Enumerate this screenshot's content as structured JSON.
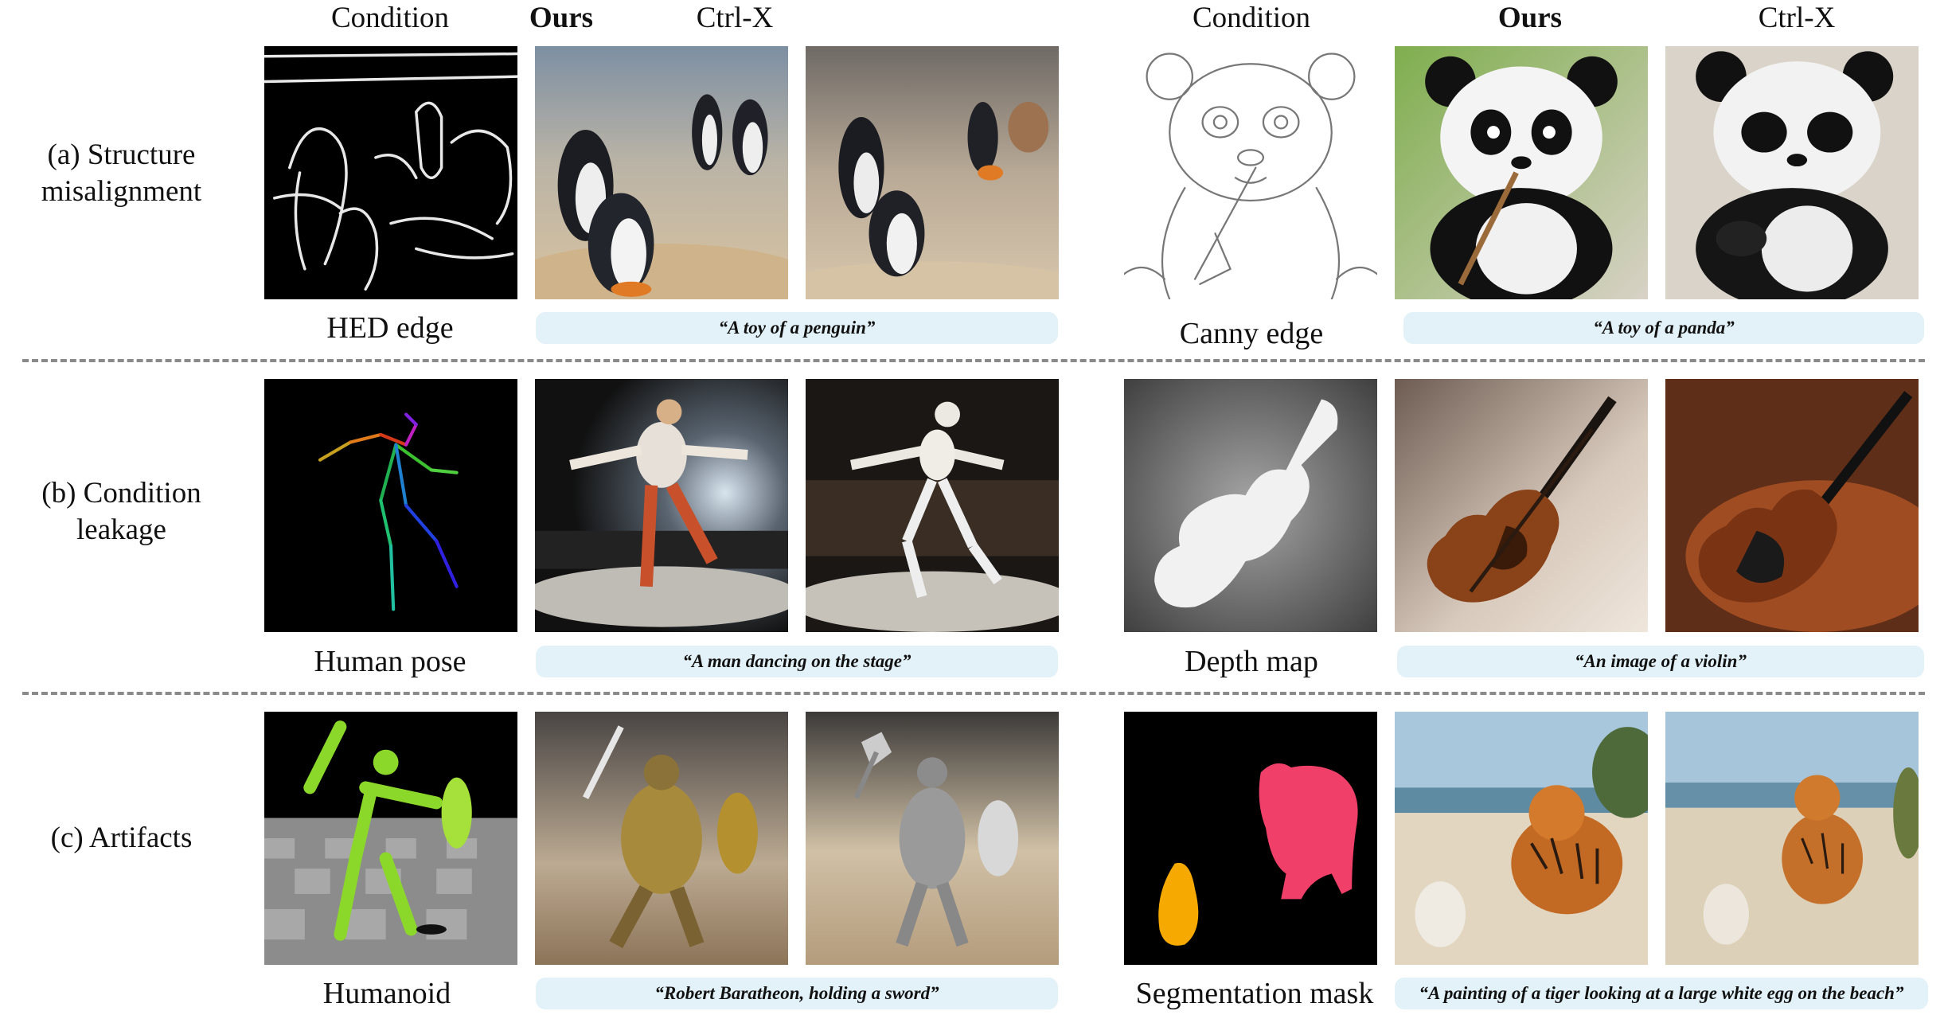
{
  "headers": {
    "condition": "Condition",
    "ours": "Ours",
    "ctrlx": "Ctrl-X"
  },
  "rows": [
    {
      "label_line1": "(a) Structure",
      "label_line2": "misalignment",
      "left": {
        "condition_label": "HED edge",
        "prompt": "“A toy of a penguin”"
      },
      "right": {
        "condition_label": "Canny edge",
        "prompt": "“A toy of a panda”"
      }
    },
    {
      "label_line1": "(b) Condition",
      "label_line2": "leakage",
      "left": {
        "condition_label": "Human pose",
        "prompt": "“A man dancing on the stage”"
      },
      "right": {
        "condition_label": "Depth map",
        "prompt": "“An image of a violin”"
      }
    },
    {
      "label_line1": "(c) Artifacts",
      "label_line2": "",
      "left": {
        "condition_label": "Humanoid",
        "prompt": "“Robert Baratheon, holding a sword”"
      },
      "right": {
        "condition_label": "Segmentation mask",
        "prompt": "“A painting of a tiger looking at a large white egg on the beach”"
      }
    }
  ]
}
